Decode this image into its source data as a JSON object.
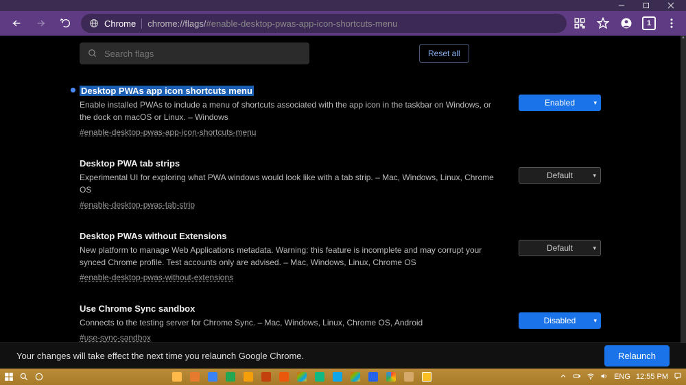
{
  "titlebar": {},
  "toolbar": {
    "site_label": "Chrome",
    "url_prefix": "chrome://flags/",
    "url_hash": "#enable-desktop-pwas-app-icon-shortcuts-menu",
    "tab_count": "1"
  },
  "search": {
    "placeholder": "Search flags",
    "reset_label": "Reset all"
  },
  "flags": [
    {
      "title": "Desktop PWAs app icon shortcuts menu",
      "desc": "Enable installed PWAs to include a menu of shortcuts associated with the app icon in the taskbar on Windows, or the dock on macOS or Linux. – Windows",
      "hash": "#enable-desktop-pwas-app-icon-shortcuts-menu",
      "value": "Enabled",
      "highlighted": true,
      "dot": true,
      "style": "enabled"
    },
    {
      "title": "Desktop PWA tab strips",
      "desc": "Experimental UI for exploring what PWA windows would look like with a tab strip. – Mac, Windows, Linux, Chrome OS",
      "hash": "#enable-desktop-pwas-tab-strip",
      "value": "Default",
      "highlighted": false,
      "dot": false,
      "style": "default"
    },
    {
      "title": "Desktop PWAs without Extensions",
      "desc": "New platform to manage Web Applications metadata. Warning: this feature is incomplete and may corrupt your synced Chrome profile. Test accounts only are advised. – Mac, Windows, Linux, Chrome OS",
      "hash": "#enable-desktop-pwas-without-extensions",
      "value": "Default",
      "highlighted": false,
      "dot": false,
      "style": "default"
    },
    {
      "title": "Use Chrome Sync sandbox",
      "desc": "Connects to the testing server for Chrome Sync. – Mac, Windows, Linux, Chrome OS, Android",
      "hash": "#use-sync-sandbox",
      "value": "Disabled",
      "highlighted": false,
      "dot": false,
      "style": "enabled"
    }
  ],
  "relaunch": {
    "msg": "Your changes will take effect the next time you relaunch Google Chrome.",
    "btn": "Relaunch"
  },
  "system_tray": {
    "lang": "ENG",
    "time": "12:55 PM"
  }
}
